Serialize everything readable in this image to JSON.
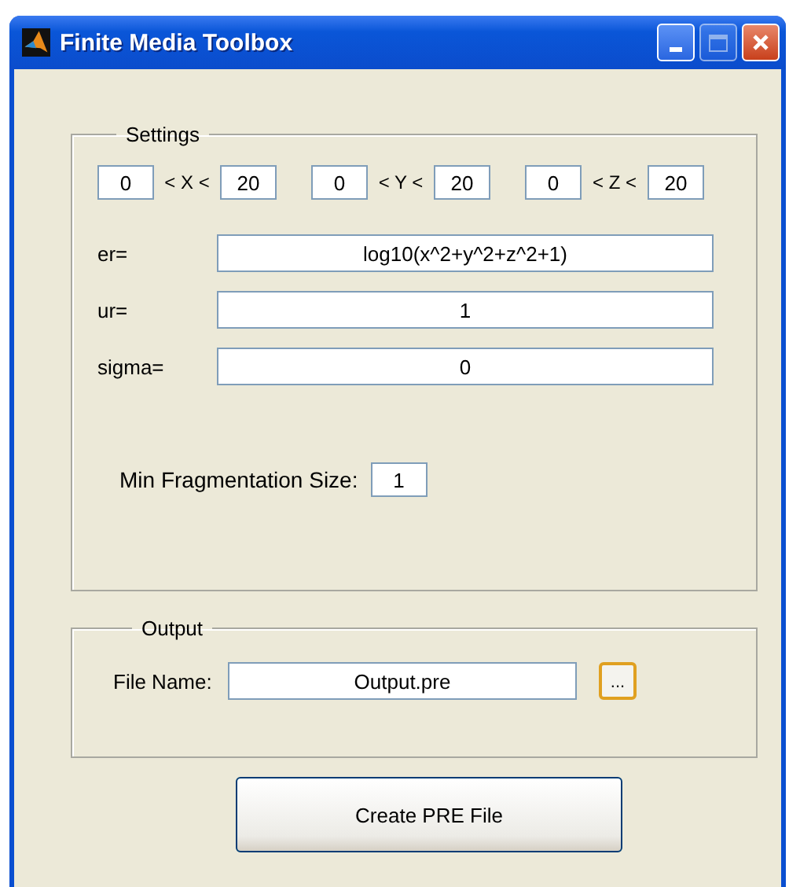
{
  "window": {
    "title": "Finite Media Toolbox"
  },
  "settings": {
    "legend": "Settings",
    "ranges": [
      {
        "min": "0",
        "label": "< X <",
        "max": "20"
      },
      {
        "min": "0",
        "label": "< Y <",
        "max": "20"
      },
      {
        "min": "0",
        "label": "< Z <",
        "max": "20"
      }
    ],
    "fields": [
      {
        "label": "er=",
        "value": "log10(x^2+y^2+z^2+1)"
      },
      {
        "label": "ur=",
        "value": "1"
      },
      {
        "label": "sigma=",
        "value": "0"
      }
    ],
    "min_fragmentation": {
      "label": "Min Fragmentation Size:",
      "value": "1"
    }
  },
  "output": {
    "legend": "Output",
    "file_name": {
      "label": "File Name:",
      "value": "Output.pre"
    },
    "browse_button": "..."
  },
  "buttons": [
    "Create PRE File"
  ]
}
